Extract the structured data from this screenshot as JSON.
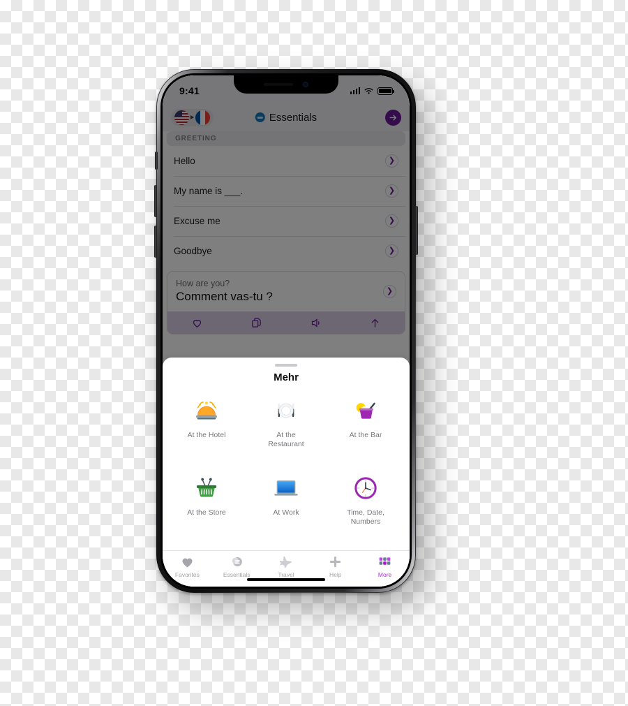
{
  "device": {
    "status_bar": {
      "time": "9:41",
      "signal_icon": "cellular-bars-icon",
      "wifi_icon": "wifi-icon",
      "battery_icon": "battery-full-icon"
    },
    "home_indicator": "home-indicator"
  },
  "nav": {
    "source_flag": "us-flag-icon",
    "target_flag": "france-flag-icon",
    "direction_icon": "arrow-right-small-icon",
    "title": "Essentials",
    "title_icon": "essentials-circle-icon",
    "next_icon": "arrow-right-circle-icon"
  },
  "list": {
    "section_header": "GREETING",
    "rows": [
      {
        "label": "Hello"
      },
      {
        "label": "My name is ___."
      },
      {
        "label": "Excuse me"
      },
      {
        "label": "Goodbye"
      }
    ],
    "chevron_icon": "chevron-right-icon"
  },
  "expanded_card": {
    "source_text": "How are you?",
    "translated_text": "Comment vas-tu ?",
    "chevron_icon": "chevron-right-icon",
    "actions": [
      {
        "name": "favorite",
        "icon": "heart-outline-icon"
      },
      {
        "name": "copy",
        "icon": "copy-icon"
      },
      {
        "name": "speak",
        "icon": "speaker-icon"
      },
      {
        "name": "share",
        "icon": "share-up-icon"
      }
    ]
  },
  "sheet": {
    "grabber": "sheet-grabber",
    "title": "Mehr",
    "items": [
      {
        "label": "At the Hotel",
        "icon": "hotel-bell-icon"
      },
      {
        "label": "At the Restaurant",
        "icon": "plate-cutlery-icon"
      },
      {
        "label": "At the Bar",
        "icon": "cocktail-icon"
      },
      {
        "label": "At the Store",
        "icon": "shopping-basket-icon"
      },
      {
        "label": "At Work",
        "icon": "laptop-icon"
      },
      {
        "label": "Time, Date, Numbers",
        "icon": "clock-icon"
      }
    ]
  },
  "tab_bar": {
    "tabs": [
      {
        "label": "Favorites",
        "icon": "heart-filled-icon",
        "active": false
      },
      {
        "label": "Essentials",
        "icon": "list-circle-icon",
        "active": false
      },
      {
        "label": "Travel",
        "icon": "airplane-icon",
        "active": false
      },
      {
        "label": "Help",
        "icon": "plus-icon",
        "active": false
      },
      {
        "label": "More",
        "icon": "grid-icon",
        "active": true
      }
    ]
  },
  "colors": {
    "accent_purple": "#6a1b9a",
    "tab_active": "#a833d6",
    "status_bar_bg": "#efeff4",
    "dim_overlay": "rgba(0,0,0,0.5)"
  }
}
